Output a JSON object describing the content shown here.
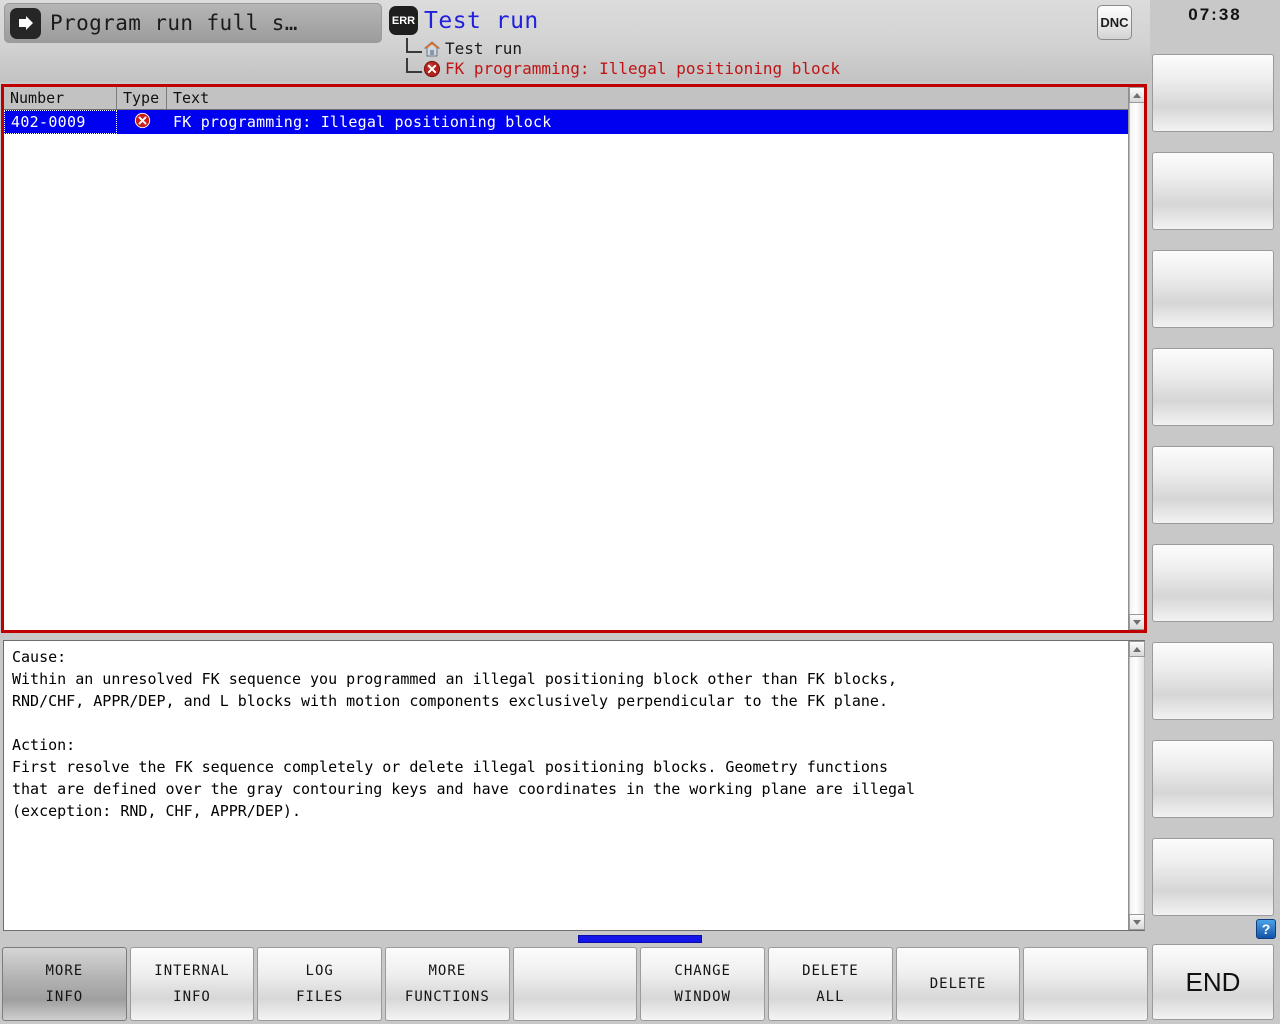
{
  "header": {
    "mode_tab_label": "Program run full s…",
    "mode_icon": "block-arrow-icon",
    "err_badge": "ERR",
    "err_title": "Test run",
    "tree": [
      {
        "icon": "home-icon",
        "label": "Test run",
        "state": "plain"
      },
      {
        "icon": "error-circle-icon",
        "label": "FK programming: Illegal positioning block",
        "state": "error"
      }
    ],
    "dnc_badge": "DNC"
  },
  "error_list": {
    "columns": [
      "Number",
      "Type",
      "Text"
    ],
    "rows": [
      {
        "number": "402-0009",
        "type_icon": "error-circle-icon",
        "text": "FK programming: Illegal positioning block",
        "selected": true
      }
    ]
  },
  "detail": {
    "body": "Cause:\nWithin an unresolved FK sequence you programmed an illegal positioning block other than FK blocks,\nRND/CHF, APPR/DEP, and L blocks with motion components exclusively perpendicular to the FK plane.\n\nAction:\nFirst resolve the FK sequence completely or delete illegal positioning blocks. Geometry functions\nthat are defined over the gray contouring keys and have coordinates in the working plane are illegal\n(exception: RND, CHF, APPR/DEP)."
  },
  "softkeys": [
    {
      "line1": "MORE",
      "line2": "INFO",
      "active": true
    },
    {
      "line1": "INTERNAL",
      "line2": "INFO",
      "active": false
    },
    {
      "line1": "LOG",
      "line2": "FILES",
      "active": false
    },
    {
      "line1": "MORE",
      "line2": "FUNCTIONS",
      "active": false
    },
    {
      "line1": "",
      "line2": "",
      "active": false
    },
    {
      "line1": "CHANGE",
      "line2": "WINDOW",
      "active": false
    },
    {
      "line1": "DELETE",
      "line2": "ALL",
      "active": false
    },
    {
      "line1": "DELETE",
      "line2": "",
      "active": false
    },
    {
      "line1": "",
      "line2": "",
      "active": false
    }
  ],
  "sidebar": {
    "clock": "07:38",
    "vertical_keys": [
      "",
      "",
      "",
      "",
      "",
      "",
      "",
      ""
    ],
    "help_icon": "?",
    "end_label": "END"
  },
  "colors": {
    "error_red": "#c00000",
    "selection_blue": "#0000f0",
    "title_blue": "#2020dd",
    "progress_blue": "#1515e8",
    "panel_gray": "#c8c8c8"
  }
}
